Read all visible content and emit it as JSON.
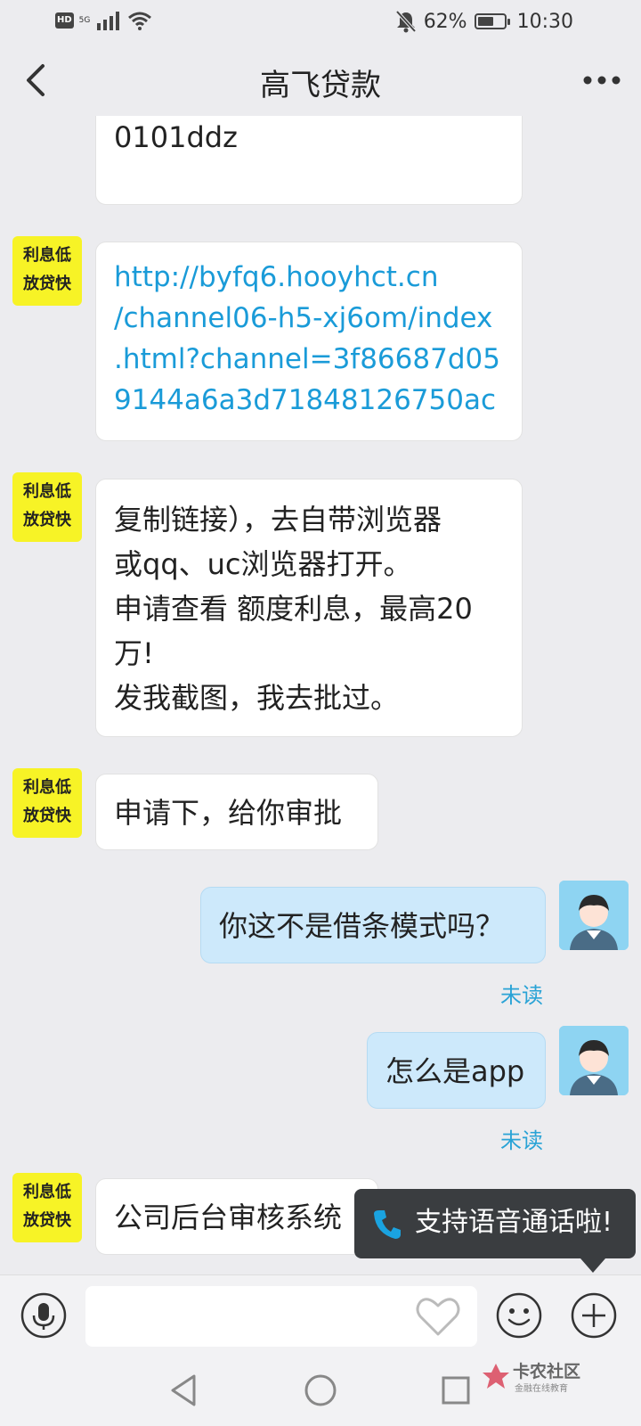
{
  "status_bar": {
    "hd": "HD",
    "network": "5G",
    "battery_percent": "62%",
    "battery_level": 0.62,
    "time": "10:30",
    "icons": [
      "signal-icon",
      "wifi-icon",
      "bell-off-icon",
      "battery-icon"
    ]
  },
  "header": {
    "title": "高飞贷款",
    "icons": [
      "back-chevron-icon",
      "more-dots-icon"
    ]
  },
  "incoming_avatar": {
    "line1": "利息低",
    "line2": "放贷快"
  },
  "messages": [
    {
      "direction": "in",
      "lines": [
        "0101ddz"
      ]
    },
    {
      "direction": "in",
      "is_link": true,
      "lines": [
        "http://byfq6.hooyhct.cn",
        "/channel06-h5-xj6om/index",
        ".html?channel=3f86687d05",
        "9144a6a3d71848126750ac"
      ]
    },
    {
      "direction": "in",
      "lines": [
        "复制链接），去自带浏览器",
        "或qq、uc浏览器打开。",
        "申请查看 额度利息，最高20",
        "万!",
        "发我截图，我去批过。"
      ]
    },
    {
      "direction": "in",
      "lines": [
        "申请下，给你审批"
      ]
    },
    {
      "direction": "out",
      "lines": [
        "你这不是借条模式吗？"
      ],
      "status": "未读"
    },
    {
      "direction": "out",
      "lines": [
        "怎么是app"
      ],
      "status": "未读"
    },
    {
      "direction": "in",
      "lines": [
        "公司后台审核系统"
      ]
    }
  ],
  "tooltip": {
    "text": "支持语音通话啦!",
    "icon": "phone-icon"
  },
  "input_bar": {
    "placeholder": "",
    "icons": [
      "microphone-icon",
      "heart-icon",
      "emoji-icon",
      "plus-icon"
    ]
  },
  "nav_bar": {
    "icons": [
      "nav-back-icon",
      "nav-home-icon",
      "nav-recent-icon"
    ]
  },
  "watermark": {
    "title": "卡农社区",
    "subtitle": "金融在线教育"
  },
  "colors": {
    "background": "#ececef",
    "incoming_bubble": "#ffffff",
    "outgoing_bubble": "#cde9fb",
    "link": "#1a9bd8",
    "unread": "#2aa3d6",
    "avatar_incoming": "#f7f326",
    "avatar_outgoing": "#8ed4f2",
    "tooltip": "#3a3d40"
  }
}
